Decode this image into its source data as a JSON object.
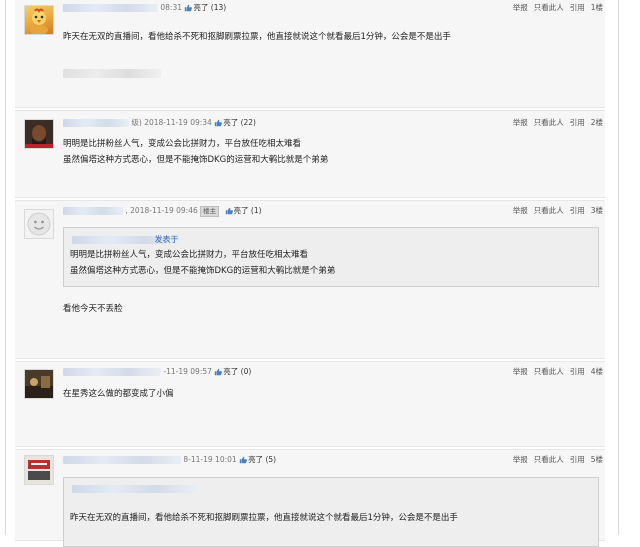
{
  "posts": [
    {
      "time": "08:31",
      "likes_label": "亮了 (13)",
      "floor": "1楼",
      "content": [
        "昨天在无双的直播间，看他给杀不死和抠脚刷票拉票，他直接就说这个就看最后1分钟，公会是不是出手"
      ]
    },
    {
      "level": "级)",
      "time": "2018-11-19 09:34",
      "likes_label": "亮了 (22)",
      "floor": "2楼",
      "content": [
        "明明是比拼粉丝人气，变成公会比拼财力，平台放任吃相太难看",
        "虽然偏塔这种方式恶心，但是不能掩饰DKG的运营和大鹌比就是个弟弟"
      ]
    },
    {
      "time": ", 2018-11-19 09:46",
      "tag": "楼主",
      "likes_label": "亮了 (1)",
      "floor": "3楼",
      "quote_name": "发表于",
      "quote": [
        "明明是比拼粉丝人气，变成公会比拼财力，平台放任吃相太难看",
        "虽然偏塔这种方式恶心，但是不能掩饰DKG的运营和大鹌比就是个弟弟"
      ],
      "content": [
        "看他今天不丢脸"
      ]
    },
    {
      "time": "-11-19 09:57",
      "likes_label": "亮了 (0)",
      "floor": "4楼",
      "content": [
        "在星秀这么做的都变成了小偏"
      ]
    },
    {
      "time": "8-11-19 10:01",
      "likes_label": "亮了 (5)",
      "floor": "5楼",
      "quote": [
        "昨天在无双的直播间，看他给杀不死和抠脚刷票拉票，他直接就说这个就看最后1分钟，公会是不是出手"
      ]
    }
  ],
  "actions": {
    "report": "举报",
    "only_this": "只看此人",
    "quote": "引用"
  },
  "colors": {
    "post_bg": "#f6f6f6",
    "quote_bg": "#eeeeee",
    "link": "#3a66b0"
  }
}
